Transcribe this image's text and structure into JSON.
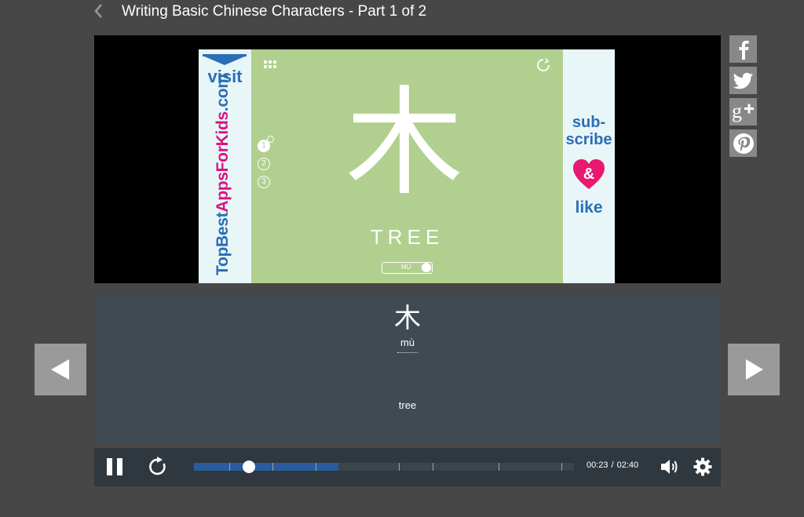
{
  "header": {
    "title": "Writing Basic Chinese Characters - Part 1 of 2",
    "back_icon": "chevron-left-icon"
  },
  "video": {
    "promo_left": {
      "visit": "visit",
      "site_part1": "TopBest",
      "site_part2": "AppsForKids",
      "site_part3": ".com",
      "colors": {
        "blue": "#2b6eb5",
        "pink": "#d8137f"
      }
    },
    "promo_right": {
      "subscribe_line1": "sub-",
      "subscribe_line2": "scribe",
      "ampersand": "&",
      "like": "like"
    },
    "app": {
      "character": "木",
      "word": "TREE",
      "pinyin_toggle": "MÙ",
      "steps": [
        "1",
        "2",
        "3"
      ],
      "completed_steps": 1,
      "background": "#b1d08f"
    }
  },
  "share": [
    {
      "name": "facebook",
      "icon": "facebook-icon"
    },
    {
      "name": "twitter",
      "icon": "twitter-icon"
    },
    {
      "name": "google-plus",
      "icon": "google-plus-icon"
    },
    {
      "name": "pinterest",
      "icon": "pinterest-icon"
    }
  ],
  "navigation": {
    "prev_icon": "triangle-left-icon",
    "next_icon": "triangle-right-icon"
  },
  "info": {
    "character": "木",
    "pinyin": "mù",
    "meaning": "tree"
  },
  "player": {
    "state": "playing",
    "current_time": "00:23",
    "separator": "/",
    "duration": "02:40",
    "progress_fraction": 0.144,
    "buffered_fraction": 0.38,
    "chapter_marks_fraction": [
      0.093,
      0.207,
      0.321,
      0.54,
      0.628,
      0.802,
      0.967
    ],
    "icons": [
      "pause-icon",
      "replay-icon",
      "volume-icon",
      "gear-icon"
    ]
  }
}
